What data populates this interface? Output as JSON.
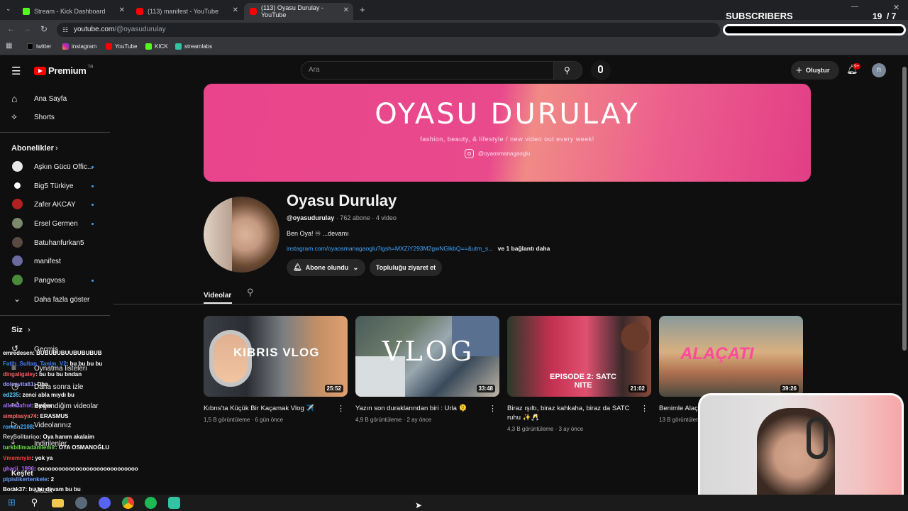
{
  "browser": {
    "tabs": [
      {
        "title": "Stream - Kick Dashboard",
        "color": "#53fc18"
      },
      {
        "title": "(113) manifest - YouTube",
        "color": "#ff0000"
      },
      {
        "title": "(113) Oyasu Durulay - YouTube",
        "color": "#ff0000"
      }
    ],
    "url_host": "youtube.com",
    "url_path": "/@oyasudurulay",
    "bookmarks": [
      "twitter",
      "instagram",
      "YouTube",
      "KICK",
      "streamlabs"
    ]
  },
  "overlay": {
    "subscribers_label": "SUBSCRIBERS",
    "subscribers_count": "19",
    "subscribers_goal": "/ 7",
    "subscribers_progress": 0
  },
  "yt": {
    "logo_text": "Premium",
    "logo_region": "TR",
    "search_placeholder": "Ara",
    "create_label": "Oluştur",
    "notif_badge": "9+",
    "avatar_letter": "n"
  },
  "sidebar": {
    "home": "Ana Sayfa",
    "shorts": "Shorts",
    "subs_header": "Abonelikler",
    "subs": [
      {
        "name": "Aşkın Gücü Offic...",
        "color": "#e8e8e8"
      },
      {
        "name": "Big5 Türkiye",
        "color": "#ffffff"
      },
      {
        "name": "Zafer AKCAY",
        "color": "#b02222"
      },
      {
        "name": "Ersel Germen",
        "color": "#7a8a6a"
      },
      {
        "name": "Batuhanfurkan5",
        "color": "#5a4a40"
      },
      {
        "name": "manifest",
        "color": "#6a6aa0"
      },
      {
        "name": "Pangvoss",
        "color": "#4a8a3a"
      }
    ],
    "show_more": "Daha fazla göster",
    "you_header": "Siz",
    "you_items": [
      "Geçmiş",
      "Oynatma listeleri",
      "Daha sonra izle",
      "Beğendiğim videolar",
      "Videolarınız",
      "İndirilenler"
    ],
    "explore": "Keşfet",
    "music": "Müzik"
  },
  "channel": {
    "banner_title": "OYASU DURULAY",
    "banner_subtitle": "fashion, beauty, & lifestyle / new video out every week!",
    "banner_handle": "@oyaosmanagaoglu",
    "name": "Oyasu Durulay",
    "handle": "@oyasudurulay",
    "stats": "· 762 abone · 4 video",
    "description": "Ben Oya! ♾ ...devamı",
    "link": "instagram.com/oyaosmanagaoglu?igsh=MXZiY293M2gwNGlkbQ==&utm_s...",
    "link_more": "ve 1 bağlantı daha",
    "subscribed_label": "Abone olundu",
    "community_label": "Topluluğu ziyaret et",
    "tab_videos": "Videolar"
  },
  "videos": [
    {
      "title": "Kıbrıs'ta Küçük Bir Kaçamak Vlog ✈️",
      "meta": "1,5 B görüntüleme · 6 gün önce",
      "duration": "25:52",
      "thumb_text": "KIBRIS VLOG"
    },
    {
      "title": "Yazın son duraklarından biri : Urla 🫠",
      "meta": "4,9 B görüntüleme · 2 ay önce",
      "duration": "33:48",
      "thumb_text": "VLOG"
    },
    {
      "title": "Biraz ışıltı, biraz kahkaha, biraz da SATC ruhu ✨🥂",
      "meta": "4,3 B görüntüleme · 3 ay önce",
      "duration": "21:02",
      "thumb_text": "EPISODE 2: SATC NITE"
    },
    {
      "title": "Benimle Alaç...",
      "meta": "13 B görüntüleme",
      "duration": "39:26",
      "thumb_text": "ALAÇATI"
    }
  ],
  "chat": [
    {
      "user": "emredesen",
      "msg": ": BUBUBUBUUBUBUBUB",
      "color": "#ffffff"
    },
    {
      "user": "Fatih_Sultan_Tanim_V2",
      "msg": ": bu bu bu bu",
      "color": "#3f7fff"
    },
    {
      "user": "dingaligaley",
      "msg": ": bu bu bu bndan",
      "color": "#ff5a5a"
    },
    {
      "user": "dolcevita61",
      "msg": ": Dba",
      "color": "#9a9aff"
    },
    {
      "user": "ed235",
      "msg": ": zenci abla mıydı bu",
      "color": "#5ad0ff"
    },
    {
      "user": "allendafrot",
      "msg": ": oyasu",
      "color": "#a06aff"
    },
    {
      "user": "simplasya74",
      "msg": ": ERASMUS",
      "color": "#ff6a6a"
    },
    {
      "user": "roman2108",
      "msg": ":",
      "color": "#4ab0ff"
    },
    {
      "user": "ReySolitarioo",
      "msg": ": Oya hanım akalaim",
      "color": "#d0d0d0"
    },
    {
      "user": "turkbilimadamiemir",
      "msg": ": OYA OSMANOĞLU",
      "color": "#6ae04a"
    },
    {
      "user": "Vmemnyin",
      "msg": ": yok ya",
      "color": "#ff3a3a"
    },
    {
      "user": "gharii_1996",
      "msg": ": ooooooooooooooooooooooooooooo",
      "color": "#b06aff"
    },
    {
      "user": "pipislikertenkele",
      "msg": ": 2",
      "color": "#6aa0ff"
    },
    {
      "user": "Borak37",
      "msg": ": bu bu devam bu bu",
      "color": "#ffffff"
    }
  ]
}
